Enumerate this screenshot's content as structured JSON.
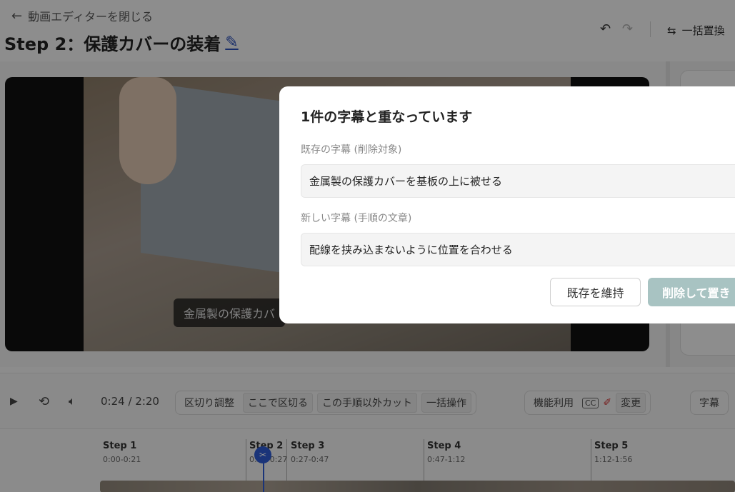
{
  "header": {
    "back_label": "動画エディターを閉じる",
    "title": "Step 2：保護カバーの装着",
    "bulk_replace_label": "一括置換"
  },
  "video": {
    "caption": "金属製の保護カバ"
  },
  "controls": {
    "time": "0:24 / 2:20",
    "split_adjust": "区切り調整",
    "split_here": "ここで区切る",
    "cut_others": "この手順以外カット",
    "bulk_ops": "一括操作",
    "feature_use": "機能利用",
    "cc": "CC",
    "change": "変更",
    "subtitle": "字幕"
  },
  "timeline": {
    "steps": [
      {
        "name": "Step 1",
        "range": "0:00-0:21"
      },
      {
        "name": "Step 2",
        "range": "0:21-0:27"
      },
      {
        "name": "Step 3",
        "range": "0:27-0:47"
      },
      {
        "name": "Step 4",
        "range": "0:47-1:12"
      },
      {
        "name": "Step 5",
        "range": "1:12-1:56"
      }
    ]
  },
  "dialog": {
    "title": "1件の字幕と重なっています",
    "existing_label": "既存の字幕 (削除対象)",
    "existing_value": "金属製の保護カバーを基板の上に被せる",
    "new_label": "新しい字幕 (手順の文章)",
    "new_value": "配線を挟み込まないように位置を合わせる",
    "keep_button": "既存を維持",
    "replace_button": "削除して置き"
  },
  "icons": {
    "back": "arrow-left-icon",
    "edit": "pencil-icon",
    "undo": "undo-icon",
    "redo": "redo-icon",
    "replace": "swap-icon",
    "play": "play-icon",
    "loop": "loop-icon",
    "volume": "volume-icon",
    "playhead": "scissors-icon"
  },
  "colors": {
    "accent": "#2d5bd0",
    "replace_button": "#a8c3c2"
  }
}
